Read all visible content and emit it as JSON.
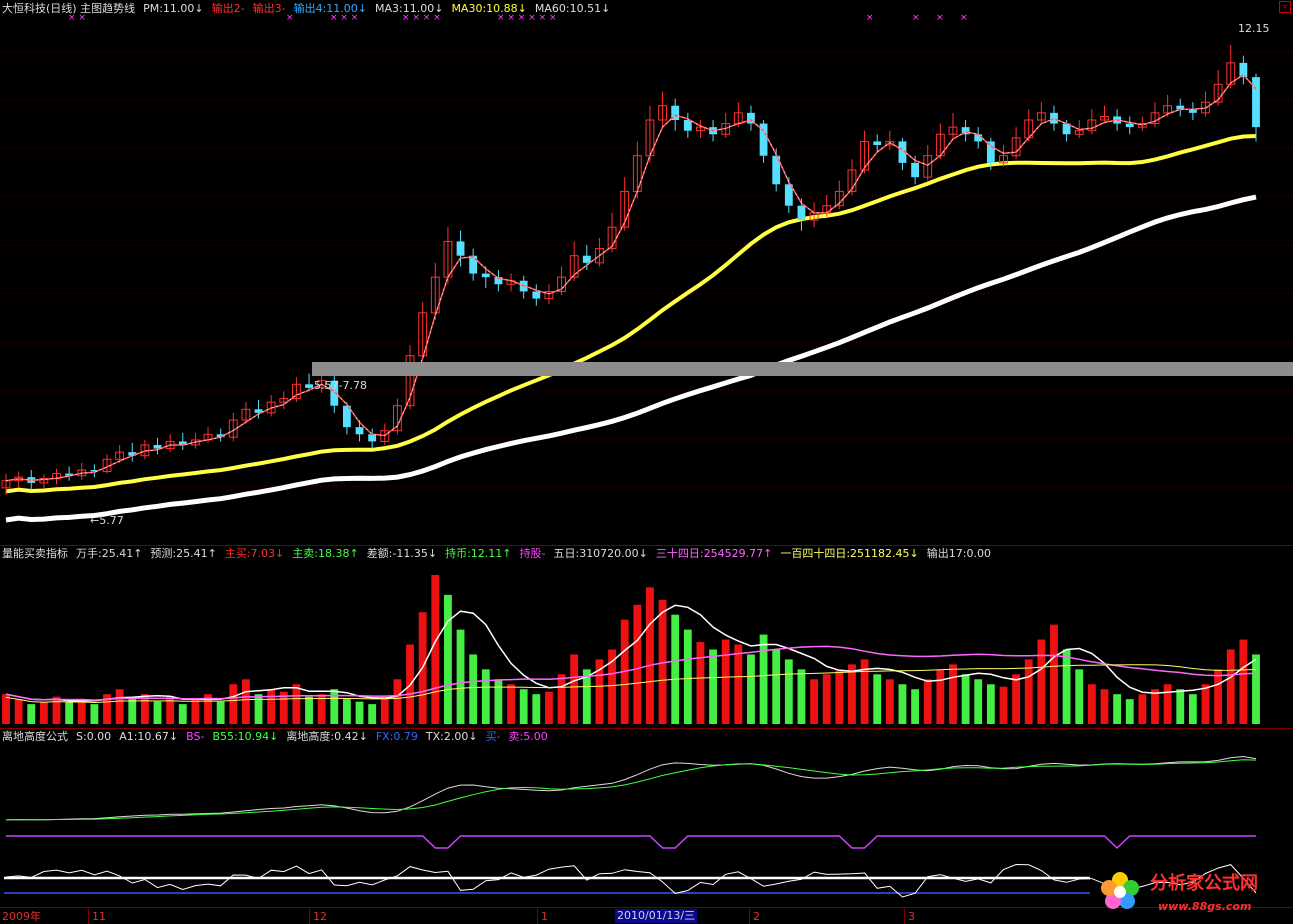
{
  "header1": [
    {
      "text": "大恒科技(日线) 主图趋势线",
      "color": "#dcdcdc"
    },
    {
      "text": "PM:11.00↓",
      "color": "#dcdcdc"
    },
    {
      "text": "输出2-",
      "color": "#ff3030"
    },
    {
      "text": "输出3-",
      "color": "#ff3030"
    },
    {
      "text": "输出4:11.00↓",
      "color": "#33aaff"
    },
    {
      "text": "MA3:11.00↓",
      "color": "#dcdcdc"
    },
    {
      "text": "MA30:10.88↓",
      "color": "#ffff44"
    },
    {
      "text": "MA60:10.51↓",
      "color": "#dcdcdc"
    }
  ],
  "header2": [
    {
      "text": "量能买卖指标",
      "color": "#dcdcdc"
    },
    {
      "text": "万手:25.41↑",
      "color": "#dcdcdc"
    },
    {
      "text": "预测:25.41↑",
      "color": "#dcdcdc"
    },
    {
      "text": "主买:7.03↓",
      "color": "#ff3030"
    },
    {
      "text": "主卖:18.38↑",
      "color": "#44ff44"
    },
    {
      "text": "差额:-11.35↓",
      "color": "#dcdcdc"
    },
    {
      "text": "持币:12.11↑",
      "color": "#44ff44"
    },
    {
      "text": "持股-",
      "color": "#ff44ff"
    },
    {
      "text": "五日:310720.00↓",
      "color": "#dcdcdc"
    },
    {
      "text": "三十四日:254529.77↑",
      "color": "#ff66ff"
    },
    {
      "text": "一百四十四日:251182.45↓",
      "color": "#ffff66"
    },
    {
      "text": "输出17:0.00",
      "color": "#dcdcdc"
    }
  ],
  "header3": [
    {
      "text": "离地高度公式",
      "color": "#dcdcdc"
    },
    {
      "text": "S:0.00",
      "color": "#dcdcdc"
    },
    {
      "text": "A1:10.67↓",
      "color": "#dcdcdc"
    },
    {
      "text": "BS-",
      "color": "#ff44ff"
    },
    {
      "text": "B55:10.94↓",
      "color": "#44ff44"
    },
    {
      "text": "离地高度:0.42↓",
      "color": "#dcdcdc"
    },
    {
      "text": "FX:0.79",
      "color": "#3366ff"
    },
    {
      "text": "TX:2.00↓",
      "color": "#dcdcdc"
    },
    {
      "text": "买-",
      "color": "#3366ff"
    },
    {
      "text": "卖:5.00",
      "color": "#ff44ff"
    }
  ],
  "annotations": {
    "high": "12.15",
    "low": "←5.77",
    "range": "5.57-7.78"
  },
  "xaxis": {
    "labels": [
      {
        "text": "2009年"
      },
      {
        "text": "11"
      },
      {
        "text": "12"
      },
      {
        "text": "1"
      },
      {
        "text": "2"
      },
      {
        "text": "3"
      }
    ],
    "selected_date": "2010/01/13/三"
  },
  "logo": {
    "text": "分析家公式网",
    "url": "www.88gs.com"
  },
  "colors": {
    "up": "#ff3030",
    "down": "#55e0ff",
    "ma30": "#ffff44",
    "ma60": "#ffffff",
    "vol_up": "#ee1111",
    "vol_down": "#44ee44"
  },
  "chart_data": {
    "type": "candlestick",
    "price_range": [
      5.5,
      12.5
    ],
    "candles": [
      [
        5.95,
        6.05,
        6.15,
        5.85
      ],
      [
        6.05,
        6.1,
        6.18,
        5.95
      ],
      [
        6.1,
        6.02,
        6.2,
        5.92
      ],
      [
        6.02,
        6.08,
        6.14,
        5.94
      ],
      [
        6.08,
        6.15,
        6.22,
        6.0
      ],
      [
        6.15,
        6.12,
        6.25,
        6.05
      ],
      [
        6.12,
        6.2,
        6.3,
        6.06
      ],
      [
        6.2,
        6.18,
        6.28,
        6.1
      ],
      [
        6.18,
        6.35,
        6.42,
        6.15
      ],
      [
        6.35,
        6.45,
        6.55,
        6.3
      ],
      [
        6.45,
        6.4,
        6.58,
        6.32
      ],
      [
        6.4,
        6.55,
        6.62,
        6.35
      ],
      [
        6.55,
        6.5,
        6.65,
        6.42
      ],
      [
        6.5,
        6.6,
        6.7,
        6.45
      ],
      [
        6.6,
        6.55,
        6.72,
        6.48
      ],
      [
        6.55,
        6.62,
        6.72,
        6.5
      ],
      [
        6.62,
        6.7,
        6.8,
        6.58
      ],
      [
        6.7,
        6.66,
        6.78,
        6.6
      ],
      [
        6.66,
        6.9,
        7.0,
        6.6
      ],
      [
        6.9,
        7.05,
        7.15,
        6.85
      ],
      [
        7.05,
        7.0,
        7.18,
        6.92
      ],
      [
        7.0,
        7.15,
        7.25,
        6.95
      ],
      [
        7.15,
        7.2,
        7.3,
        7.05
      ],
      [
        7.2,
        7.4,
        7.5,
        7.15
      ],
      [
        7.4,
        7.35,
        7.55,
        7.3
      ],
      [
        7.35,
        7.45,
        7.6,
        7.28
      ],
      [
        7.45,
        7.1,
        7.52,
        7.0
      ],
      [
        7.1,
        6.8,
        7.15,
        6.7
      ],
      [
        6.8,
        6.7,
        6.9,
        6.6
      ],
      [
        6.7,
        6.6,
        6.78,
        6.5
      ],
      [
        6.6,
        6.75,
        6.85,
        6.55
      ],
      [
        6.75,
        7.1,
        7.2,
        6.7
      ],
      [
        7.1,
        7.8,
        7.95,
        7.05
      ],
      [
        7.8,
        8.4,
        8.55,
        7.75
      ],
      [
        8.4,
        8.9,
        9.1,
        8.3
      ],
      [
        8.9,
        9.4,
        9.6,
        8.8
      ],
      [
        9.4,
        9.2,
        9.55,
        9.05
      ],
      [
        9.2,
        8.95,
        9.3,
        8.85
      ],
      [
        8.95,
        8.9,
        9.05,
        8.75
      ],
      [
        8.9,
        8.8,
        9.0,
        8.7
      ],
      [
        8.8,
        8.85,
        8.95,
        8.7
      ],
      [
        8.85,
        8.7,
        8.92,
        8.6
      ],
      [
        8.7,
        8.6,
        8.8,
        8.5
      ],
      [
        8.6,
        8.7,
        8.8,
        8.52
      ],
      [
        8.7,
        8.9,
        9.05,
        8.65
      ],
      [
        8.9,
        9.2,
        9.4,
        8.85
      ],
      [
        9.2,
        9.1,
        9.35,
        9.0
      ],
      [
        9.1,
        9.3,
        9.45,
        9.05
      ],
      [
        9.3,
        9.6,
        9.8,
        9.25
      ],
      [
        9.6,
        10.1,
        10.3,
        9.55
      ],
      [
        10.1,
        10.6,
        10.8,
        10.0
      ],
      [
        10.6,
        11.1,
        11.3,
        10.5
      ],
      [
        11.1,
        11.3,
        11.5,
        11.0
      ],
      [
        11.3,
        11.1,
        11.4,
        10.95
      ],
      [
        11.1,
        10.95,
        11.2,
        10.85
      ],
      [
        10.95,
        11.0,
        11.1,
        10.85
      ],
      [
        11.0,
        10.9,
        11.1,
        10.8
      ],
      [
        10.9,
        11.05,
        11.2,
        10.85
      ],
      [
        11.05,
        11.2,
        11.35,
        11.0
      ],
      [
        11.2,
        11.05,
        11.3,
        10.95
      ],
      [
        11.05,
        10.6,
        11.1,
        10.5
      ],
      [
        10.6,
        10.2,
        10.7,
        10.1
      ],
      [
        10.2,
        9.9,
        10.3,
        9.8
      ],
      [
        9.9,
        9.7,
        10.0,
        9.55
      ],
      [
        9.7,
        9.8,
        9.95,
        9.6
      ],
      [
        9.8,
        9.9,
        10.05,
        9.75
      ],
      [
        9.9,
        10.1,
        10.25,
        9.85
      ],
      [
        10.1,
        10.4,
        10.55,
        10.05
      ],
      [
        10.4,
        10.8,
        10.95,
        10.35
      ],
      [
        10.8,
        10.75,
        10.9,
        10.65
      ],
      [
        10.75,
        10.8,
        10.95,
        10.68
      ],
      [
        10.8,
        10.5,
        10.85,
        10.4
      ],
      [
        10.5,
        10.3,
        10.6,
        10.2
      ],
      [
        10.3,
        10.6,
        10.75,
        10.25
      ],
      [
        10.6,
        10.9,
        11.05,
        10.55
      ],
      [
        10.9,
        11.0,
        11.2,
        10.85
      ],
      [
        11.0,
        10.9,
        11.1,
        10.8
      ],
      [
        10.9,
        10.8,
        11.0,
        10.7
      ],
      [
        10.8,
        10.5,
        10.85,
        10.4
      ],
      [
        10.5,
        10.6,
        10.75,
        10.45
      ],
      [
        10.6,
        10.85,
        11.0,
        10.55
      ],
      [
        10.85,
        11.1,
        11.25,
        10.8
      ],
      [
        11.1,
        11.2,
        11.35,
        11.05
      ],
      [
        11.2,
        11.05,
        11.3,
        10.95
      ],
      [
        11.05,
        10.9,
        11.1,
        10.8
      ],
      [
        10.9,
        10.95,
        11.1,
        10.85
      ],
      [
        10.95,
        11.1,
        11.25,
        10.9
      ],
      [
        11.1,
        11.15,
        11.3,
        11.05
      ],
      [
        11.15,
        11.05,
        11.25,
        10.95
      ],
      [
        11.05,
        11.0,
        11.15,
        10.9
      ],
      [
        11.0,
        11.05,
        11.15,
        10.95
      ],
      [
        11.05,
        11.2,
        11.35,
        11.0
      ],
      [
        11.2,
        11.3,
        11.45,
        11.15
      ],
      [
        11.3,
        11.25,
        11.4,
        11.15
      ],
      [
        11.25,
        11.2,
        11.35,
        11.1
      ],
      [
        11.2,
        11.35,
        11.5,
        11.15
      ],
      [
        11.35,
        11.6,
        11.8,
        11.3
      ],
      [
        11.6,
        11.9,
        12.15,
        11.55
      ],
      [
        11.9,
        11.7,
        12.0,
        11.6
      ],
      [
        11.7,
        11.0,
        11.75,
        10.8
      ]
    ],
    "volume": [
      [
        12,
        1
      ],
      [
        10,
        1
      ],
      [
        8,
        0
      ],
      [
        9,
        1
      ],
      [
        11,
        1
      ],
      [
        9,
        0
      ],
      [
        10,
        1
      ],
      [
        8,
        0
      ],
      [
        12,
        1
      ],
      [
        14,
        1
      ],
      [
        10,
        0
      ],
      [
        12,
        1
      ],
      [
        9,
        0
      ],
      [
        11,
        1
      ],
      [
        8,
        0
      ],
      [
        10,
        1
      ],
      [
        12,
        1
      ],
      [
        9,
        0
      ],
      [
        16,
        1
      ],
      [
        18,
        1
      ],
      [
        12,
        0
      ],
      [
        14,
        1
      ],
      [
        13,
        1
      ],
      [
        16,
        1
      ],
      [
        11,
        0
      ],
      [
        12,
        1
      ],
      [
        14,
        0
      ],
      [
        10,
        0
      ],
      [
        9,
        0
      ],
      [
        8,
        0
      ],
      [
        11,
        1
      ],
      [
        18,
        1
      ],
      [
        32,
        1
      ],
      [
        45,
        1
      ],
      [
        60,
        1
      ],
      [
        52,
        0
      ],
      [
        38,
        0
      ],
      [
        28,
        0
      ],
      [
        22,
        0
      ],
      [
        18,
        0
      ],
      [
        16,
        1
      ],
      [
        14,
        0
      ],
      [
        12,
        0
      ],
      [
        13,
        1
      ],
      [
        20,
        1
      ],
      [
        28,
        1
      ],
      [
        22,
        0
      ],
      [
        26,
        1
      ],
      [
        30,
        1
      ],
      [
        42,
        1
      ],
      [
        48,
        1
      ],
      [
        55,
        1
      ],
      [
        50,
        1
      ],
      [
        44,
        0
      ],
      [
        38,
        0
      ],
      [
        33,
        1
      ],
      [
        30,
        0
      ],
      [
        34,
        1
      ],
      [
        32,
        1
      ],
      [
        28,
        0
      ],
      [
        36,
        0
      ],
      [
        30,
        0
      ],
      [
        26,
        0
      ],
      [
        22,
        0
      ],
      [
        18,
        1
      ],
      [
        20,
        1
      ],
      [
        22,
        1
      ],
      [
        24,
        1
      ],
      [
        26,
        1
      ],
      [
        20,
        0
      ],
      [
        18,
        1
      ],
      [
        16,
        0
      ],
      [
        14,
        0
      ],
      [
        18,
        1
      ],
      [
        22,
        1
      ],
      [
        24,
        1
      ],
      [
        20,
        0
      ],
      [
        18,
        0
      ],
      [
        16,
        0
      ],
      [
        15,
        1
      ],
      [
        20,
        1
      ],
      [
        26,
        1
      ],
      [
        34,
        1
      ],
      [
        40,
        1
      ],
      [
        30,
        0
      ],
      [
        22,
        0
      ],
      [
        16,
        1
      ],
      [
        14,
        1
      ],
      [
        12,
        0
      ],
      [
        10,
        0
      ],
      [
        12,
        1
      ],
      [
        14,
        1
      ],
      [
        16,
        1
      ],
      [
        14,
        0
      ],
      [
        12,
        0
      ],
      [
        16,
        1
      ],
      [
        22,
        1
      ],
      [
        30,
        1
      ],
      [
        34,
        1
      ],
      [
        28,
        0
      ]
    ]
  }
}
